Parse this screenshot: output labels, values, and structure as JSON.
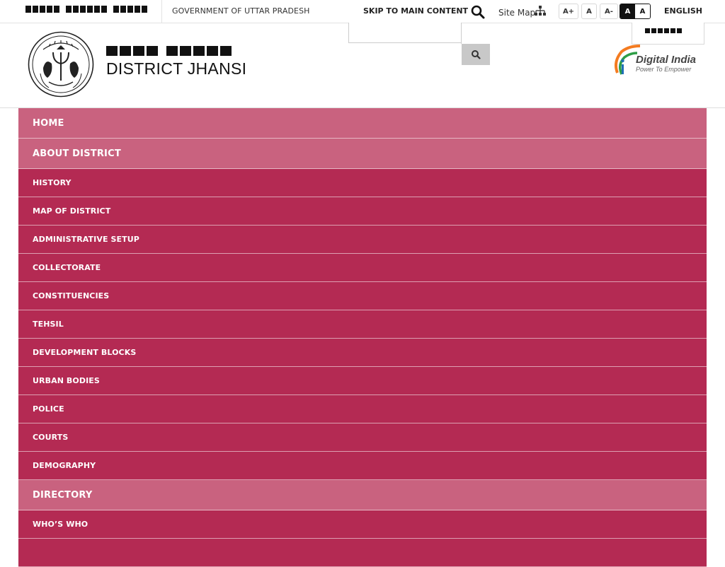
{
  "topbar": {
    "gov_hindi_text": "उत्तर प्रदेश सरकार",
    "gov_english": "GOVERNMENT OF UTTAR PRADESH",
    "skip_link": "SKIP TO MAIN CONTENT",
    "search_icon": "search-icon",
    "sitemap_label": "Site Map",
    "sitemap_icon": "sitemap-icon",
    "font_size_buttons": [
      "A+",
      "A",
      "A-"
    ],
    "contrast_buttons": [
      "A",
      "A"
    ],
    "language": "ENGLISH",
    "language_alt": "हिन्दी"
  },
  "header": {
    "title_hindi": "जिला झाँसी",
    "title_english": "DISTRICT JHANSI",
    "emblem_text": "उत्तर प्रदेश सरकार",
    "search_placeholder": "",
    "digital_india": "Digital India",
    "digital_india_tagline": "Power To Empower"
  },
  "menu": {
    "items": [
      {
        "label": "HOME",
        "level": 1
      },
      {
        "label": "ABOUT DISTRICT",
        "level": 1
      },
      {
        "label": "HISTORY",
        "level": 2
      },
      {
        "label": "MAP OF DISTRICT",
        "level": 2
      },
      {
        "label": "ADMINISTRATIVE SETUP",
        "level": 2
      },
      {
        "label": "COLLECTORATE",
        "level": 2
      },
      {
        "label": "CONSTITUENCIES",
        "level": 2
      },
      {
        "label": "TEHSIL",
        "level": 2
      },
      {
        "label": "DEVELOPMENT BLOCKS",
        "level": 2
      },
      {
        "label": "URBAN BODIES",
        "level": 2
      },
      {
        "label": "POLICE",
        "level": 2
      },
      {
        "label": "COURTS",
        "level": 2
      },
      {
        "label": "DEMOGRAPHY",
        "level": 2
      },
      {
        "label": "DIRECTORY",
        "level": 1
      },
      {
        "label": "WHO’S WHO",
        "level": 2
      }
    ]
  },
  "colors": {
    "menu_primary": "#c9627f",
    "menu_secondary": "#b42a53"
  }
}
